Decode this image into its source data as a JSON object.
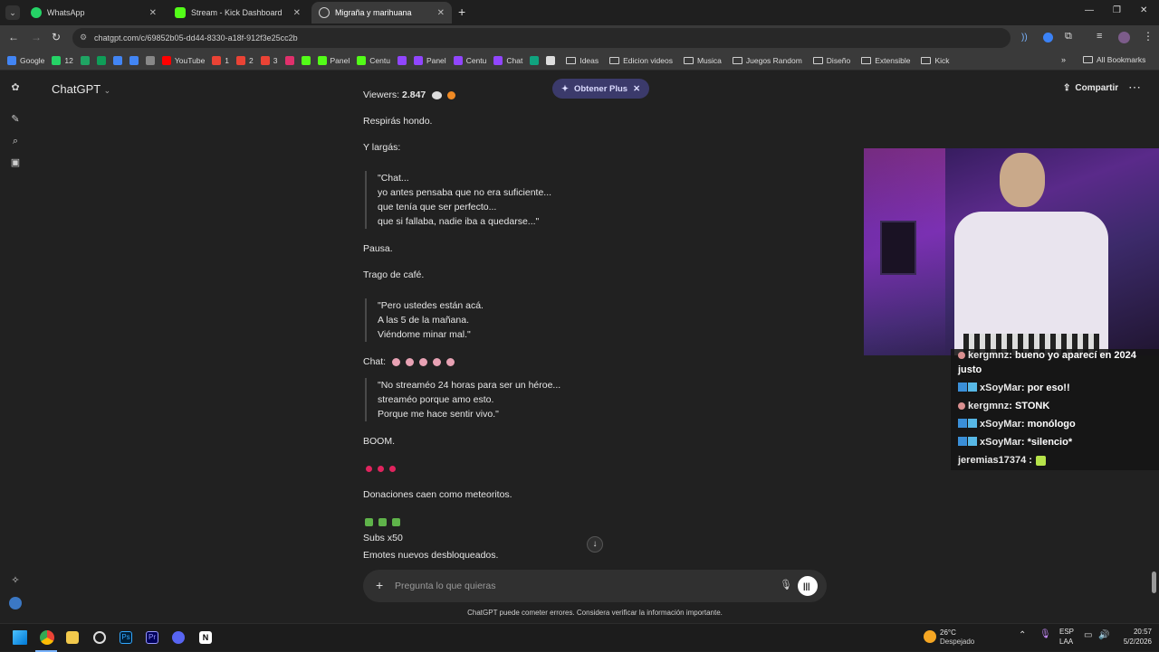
{
  "browser": {
    "tabs": [
      {
        "title": "WhatsApp",
        "color": "#25d366"
      },
      {
        "title": "Stream - Kick Dashboard",
        "color": "#53fc18"
      },
      {
        "title": "Migraña y marihuana",
        "color": "#cfcfcf"
      }
    ],
    "url": "chatgpt.com/c/69852b05-dd44-8330-a18f-912f3e25cc2b",
    "bookmarks": [
      {
        "label": "Google",
        "color": "#4285f4"
      },
      {
        "label": "12",
        "color": "#25d366"
      },
      {
        "label": "",
        "color": "#1fa463"
      },
      {
        "label": "",
        "color": "#0f9d58"
      },
      {
        "label": "",
        "color": "#4285f4"
      },
      {
        "label": "",
        "color": "#4285f4"
      },
      {
        "label": "",
        "color": "#888888"
      },
      {
        "label": "YouTube",
        "color": "#ff0000"
      },
      {
        "label": "1",
        "color": "#ea4335"
      },
      {
        "label": "2",
        "color": "#ea4335"
      },
      {
        "label": "3",
        "color": "#ea4335"
      },
      {
        "label": "",
        "color": "#e1306c"
      },
      {
        "label": "",
        "color": "#53fc18"
      },
      {
        "label": "Panel",
        "color": "#53fc18"
      },
      {
        "label": "Centu",
        "color": "#53fc18"
      },
      {
        "label": "",
        "color": "#9146ff"
      },
      {
        "label": "Panel",
        "color": "#9146ff"
      },
      {
        "label": "Centu",
        "color": "#9146ff"
      },
      {
        "label": "Chat",
        "color": "#9146ff"
      },
      {
        "label": "",
        "color": "#10a37f"
      },
      {
        "label": "",
        "color": "#dddddd"
      }
    ],
    "bookmark_folders": [
      "Ideas",
      "Edicion videos",
      "Musica",
      "Juegos Random",
      "Diseño",
      "Extensible",
      "Kick"
    ],
    "all_bookmarks": "All Bookmarks"
  },
  "chatgpt": {
    "brand": "ChatGPT",
    "upgrade_label": "Obtener Plus",
    "share_label": "Compartir",
    "viewers_prefix": "Viewers: ",
    "viewers_count": "2.847",
    "lines": {
      "l1": "Respirás hondo.",
      "l2": "Y largás:",
      "l3": "Pausa.",
      "l4": "Trago de café.",
      "l5": "Chat:",
      "l6": "BOOM.",
      "l7": "Donaciones caen como meteoritos.",
      "l8": "Subs x50",
      "l9": "Emotes nuevos desbloqueados."
    },
    "quote1": [
      "\"Chat...",
      "yo antes pensaba que no era suficiente...",
      "que tenía que ser perfecto...",
      "que si fallaba, nadie iba a quedarse...\""
    ],
    "quote2": [
      "\"Pero ustedes están acá.",
      "A las 5 de la mañana.",
      "Viéndome minar mal.\""
    ],
    "quote3": [
      "\"No streaméo 24 horas para ser un héroe...",
      "streaméo porque amo esto.",
      "Porque me hace sentir vivo.\""
    ],
    "composer_placeholder": "Pregunta lo que quieras",
    "disclaimer": "ChatGPT puede cometer errores. Considera verificar la información importante."
  },
  "stream_chat": {
    "messages": [
      {
        "user": "kergmnz",
        "text": ": bueno yo aparecí en 2024"
      },
      {
        "user": "",
        "text": "justo"
      },
      {
        "user": "xSoyMar",
        "text": ": por eso!!"
      },
      {
        "user": "kergmnz",
        "text": ": STONK"
      },
      {
        "user": "xSoyMar",
        "text": ": monólogo"
      },
      {
        "user": "xSoyMar",
        "text": ": *silencio*"
      },
      {
        "user": "jeremias17374",
        "text": " :"
      }
    ]
  },
  "taskbar": {
    "weather_temp": "26°C",
    "weather_desc": "Despejado",
    "lang": "ESP",
    "layout": "LAA",
    "time": "20:57",
    "date": "5/2/2026"
  }
}
